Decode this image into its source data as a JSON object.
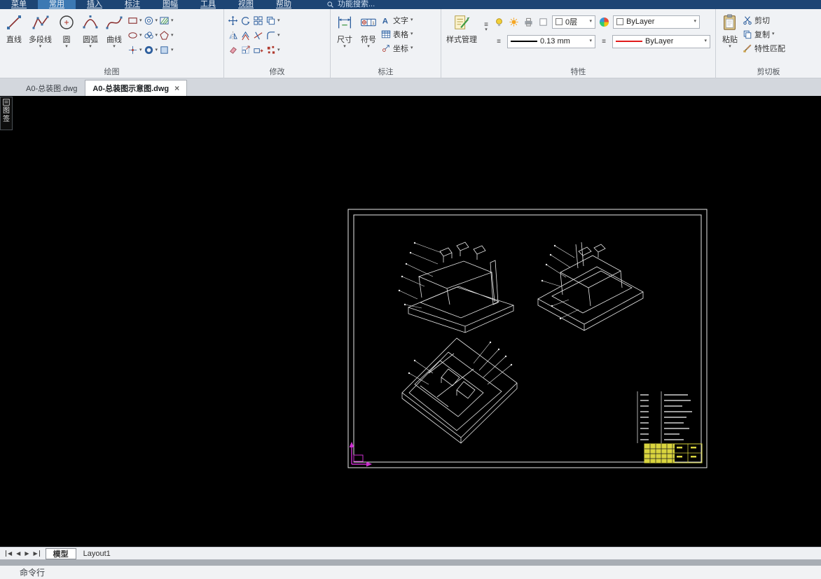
{
  "menubar": {
    "items": [
      "菜单",
      "常用",
      "插入",
      "标注",
      "图幅",
      "工具",
      "视图",
      "帮助"
    ],
    "active": "常用",
    "search_label": "功能搜索..."
  },
  "ribbon": {
    "draw": {
      "label": "绘图",
      "buttons": [
        {
          "label": "直线"
        },
        {
          "label": "多段线"
        },
        {
          "label": "圆"
        },
        {
          "label": "圆弧"
        },
        {
          "label": "曲线"
        }
      ]
    },
    "modify": {
      "label": "修改"
    },
    "annotate": {
      "label": "标注",
      "big": [
        {
          "label": "尺寸"
        },
        {
          "label": "符号"
        }
      ],
      "small": [
        {
          "label": "文字"
        },
        {
          "label": "表格"
        },
        {
          "label": "坐标"
        }
      ]
    },
    "properties": {
      "label": "特性",
      "style_manager": "样式管理",
      "layer": "0层",
      "color": "ByLayer",
      "lineweight": "0.13 mm",
      "linetype": "ByLayer"
    },
    "clipboard": {
      "label": "剪切板",
      "paste": "粘贴",
      "small": [
        {
          "label": "剪切"
        },
        {
          "label": "复制"
        },
        {
          "label": "特性匹配"
        }
      ]
    }
  },
  "doc_tabs": [
    {
      "label": "A0-总装图.dwg",
      "active": false
    },
    {
      "label": "A0-总装图示意图.dwg",
      "active": true
    }
  ],
  "palette": {
    "top": "图",
    "bottom": "签"
  },
  "statusbar": {
    "tabs": [
      {
        "label": "模型",
        "active": true
      },
      {
        "label": "Layout1",
        "active": false
      }
    ],
    "command_label": "命令行"
  },
  "icons": {
    "dropdown": "▾",
    "close": "×",
    "menu": "≡",
    "nav_prev": "◀",
    "nav_next": "▶",
    "text_a": "A",
    "dim_one": "1"
  },
  "colors": {
    "canvas_bg": "#000000",
    "wireframe": "#e8e8e8",
    "titleblock_yellow": "#d9d43e",
    "ucs_magenta": "#cc2fcf",
    "linetype_red": "#e01b1b",
    "menubar_bg": "#1d4574",
    "menubar_active": "#3c79b3"
  }
}
